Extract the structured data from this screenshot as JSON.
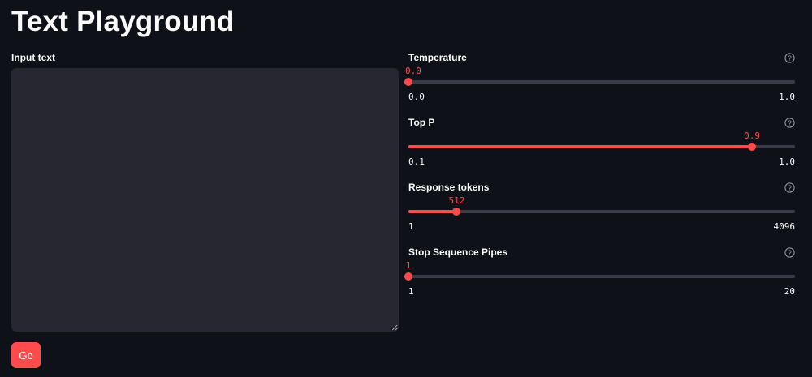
{
  "title": "Text Playground",
  "input": {
    "label": "Input text",
    "value": "",
    "placeholder": ""
  },
  "go_button": "Go",
  "sliders": [
    {
      "label": "Temperature",
      "value": 0.0,
      "display": "0.0",
      "min": 0.0,
      "max": 1.0,
      "min_label": "0.0",
      "max_label": "1.0",
      "help_icon": "help-circle-icon"
    },
    {
      "label": "Top P",
      "value": 0.9,
      "display": "0.9",
      "min": 0.1,
      "max": 1.0,
      "min_label": "0.1",
      "max_label": "1.0",
      "help_icon": "help-circle-icon"
    },
    {
      "label": "Response tokens",
      "value": 512,
      "display": "512",
      "min": 1,
      "max": 4096,
      "min_label": "1",
      "max_label": "4096",
      "help_icon": "help-circle-icon"
    },
    {
      "label": "Stop Sequence Pipes",
      "value": 1,
      "display": "1",
      "min": 1,
      "max": 20,
      "min_label": "1",
      "max_label": "20",
      "help_icon": "help-circle-icon"
    }
  ],
  "colors": {
    "background": "#0e1117",
    "accent": "#ff4b4b",
    "textarea_bg": "#262730",
    "track": "#3a3d47",
    "text": "#fafafa"
  }
}
